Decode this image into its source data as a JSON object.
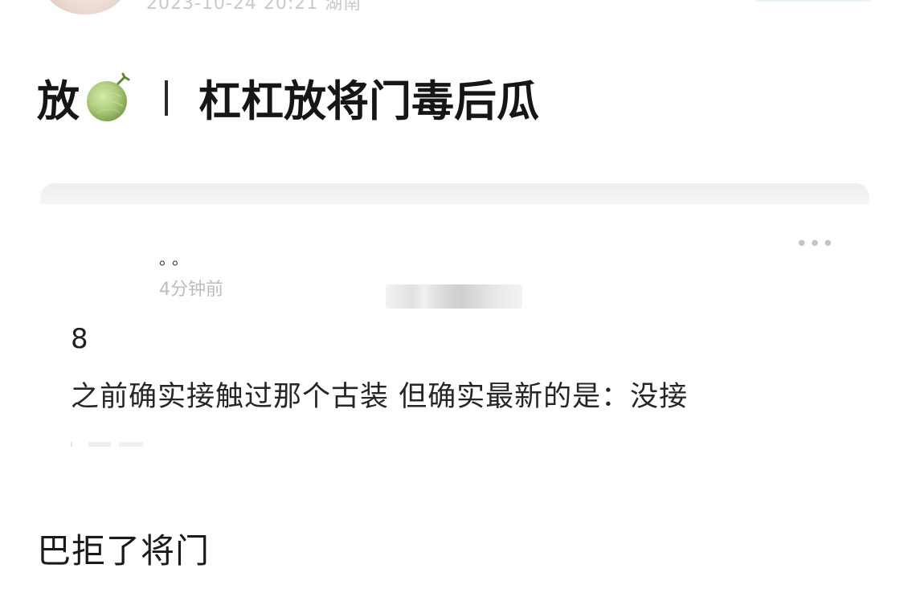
{
  "header": {
    "meta": "2023-10-24 20:21 湖南"
  },
  "post": {
    "title_prefix": "放",
    "title_icon": "melon-icon",
    "title_main": "杠杠放将门毒后瓜",
    "body": "巴拒了将门"
  },
  "embed": {
    "username": "。。",
    "time": "4分钟前",
    "more": "•••",
    "number": "8",
    "text": "之前确实接触过那个古装 但确实最新的是：没接"
  },
  "colors": {
    "melon": "#9fbf6a",
    "follow": "#e6f4ea"
  }
}
